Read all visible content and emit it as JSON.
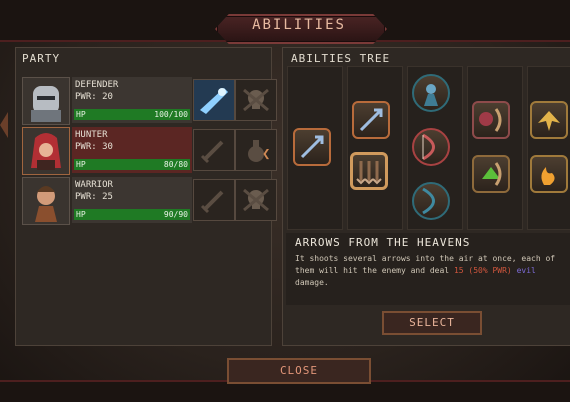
{
  "header": {
    "title": "ABILITIES"
  },
  "party": {
    "label": "PARTY",
    "members": [
      {
        "name": "DEFENDER",
        "pwr": "PWR: 20",
        "hp_label": "HP",
        "hp_value": "100/100",
        "hp_fraction": 1.0
      },
      {
        "name": "HUNTER",
        "pwr": "PWR: 30",
        "hp_label": "HP",
        "hp_value": "80/80",
        "hp_fraction": 1.0
      },
      {
        "name": "WARRIOR",
        "pwr": "PWR: 25",
        "hp_label": "HP",
        "hp_value": "90/90",
        "hp_fraction": 1.0
      }
    ]
  },
  "tree": {
    "label": "ABILTIES TREE",
    "selected_ability": {
      "title": "ARROWS FROM THE HEAVENS",
      "desc_prefix": "It shoots several arrows into the air at once, each of them will hit the enemy and deal ",
      "desc_dmg": "15 (50% PWR)",
      "desc_type": "evil",
      "desc_suffix": " damage."
    },
    "select_label": "SELECT"
  },
  "footer": {
    "close_label": "CLOSE"
  },
  "colors": {
    "hp": "#1f7a24",
    "selected_row": "#5b2623",
    "damage": "#d0563d",
    "evil": "#7c6bd6"
  }
}
